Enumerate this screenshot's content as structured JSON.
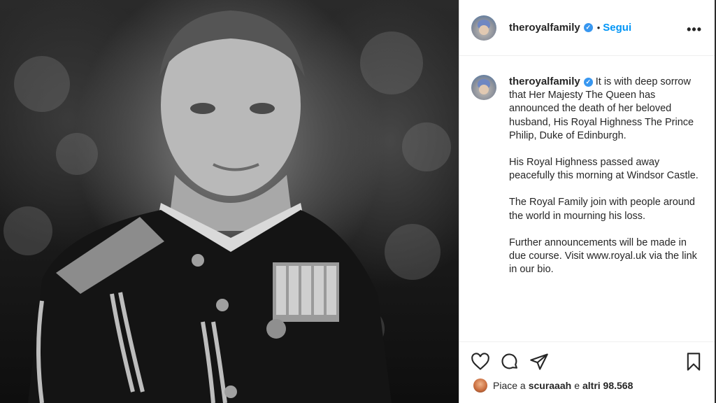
{
  "post": {
    "account": "theroyalfamily",
    "verified_symbol": "✓",
    "dot": "•",
    "follow_label": "Segui",
    "more_label": "•••"
  },
  "caption": {
    "paragraphs": [
      "It is with deep sorrow that Her Majesty The Queen has announced the death of her beloved husband, His Royal Highness The Prince Philip, Duke of Edinburgh.",
      "His Royal Highness passed away peacefully this morning at Windsor Castle.",
      "The Royal Family join with people around the world in mourning his loss.",
      "Further announcements will be made in due course. Visit www.royal.uk via the link in our bio."
    ]
  },
  "actions": {
    "icons": [
      "heart-icon",
      "comment-icon",
      "share-icon",
      "bookmark-icon"
    ]
  },
  "likes": {
    "prefix": "Piace a",
    "user": "scuraaah",
    "connector": "e",
    "others": "altri 98.568"
  },
  "colors": {
    "accent": "#0095f6",
    "verified": "#3897f0",
    "text": "#262626"
  }
}
